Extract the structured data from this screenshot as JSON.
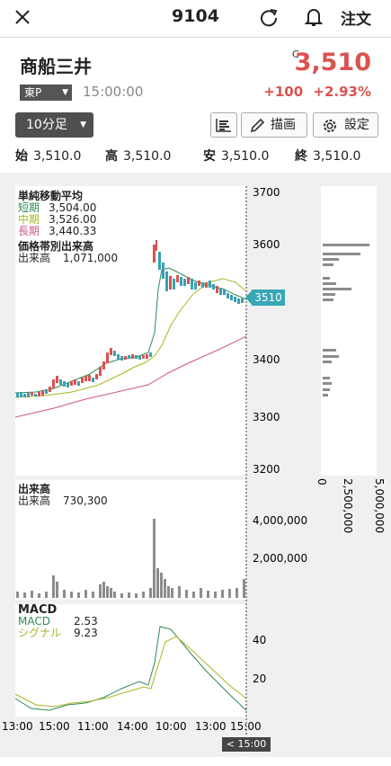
{
  "header": {
    "title": "9104",
    "order_label": "注文"
  },
  "stock": {
    "name": "商船三井",
    "c_mark": "C",
    "price": "3,510",
    "exchange": "東P",
    "time": "15:00:00",
    "change": "+100",
    "change_pct": "+2.93%"
  },
  "toolbar": {
    "interval": "10分足",
    "draw_label": "描画",
    "settings_label": "設定"
  },
  "ohlc": {
    "open_label": "始",
    "open": "3,510.0",
    "high_label": "高",
    "high": "3,510.0",
    "low_label": "安",
    "low": "3,510.0",
    "close_label": "終",
    "close": "3,510.0"
  },
  "indicators": {
    "sma_title": "単純移動平均",
    "short_label": "短期",
    "short": "3,504.00",
    "mid_label": "中期",
    "mid": "3,526.00",
    "long_label": "長期",
    "long": "3,440.33",
    "vp_title": "価格帯別出来高",
    "vp_label": "出来高",
    "vp_value": "1,071,000",
    "vol_title": "出来高",
    "vol_label": "出来高",
    "vol_value": "730,300",
    "macd_title": "MACD",
    "macd_label": "MACD",
    "macd_value": "2.53",
    "signal_label": "シグナル",
    "signal_value": "9.23"
  },
  "axes": {
    "price_ticks": [
      "3700",
      "3600",
      "3510",
      "3400",
      "3300",
      "3200"
    ],
    "volume_ticks": [
      "4,000,000",
      "2,000,000"
    ],
    "macd_ticks": [
      "40",
      "20"
    ],
    "vp_ticks": [
      "0",
      "2,500,000",
      "5,000,000"
    ],
    "time_ticks": [
      "13:00",
      "15:00",
      "11:00",
      "14:00",
      "10:00",
      "13:00",
      "15:00"
    ],
    "cursor_label": "< 15:00 >"
  },
  "colors": {
    "up": "#d9534f",
    "down": "#3aa0b3",
    "short_ma": "#2e8b57",
    "mid_ma": "#a8b820",
    "long_ma": "#d0558a",
    "price_tag": "#39a6b6"
  }
}
